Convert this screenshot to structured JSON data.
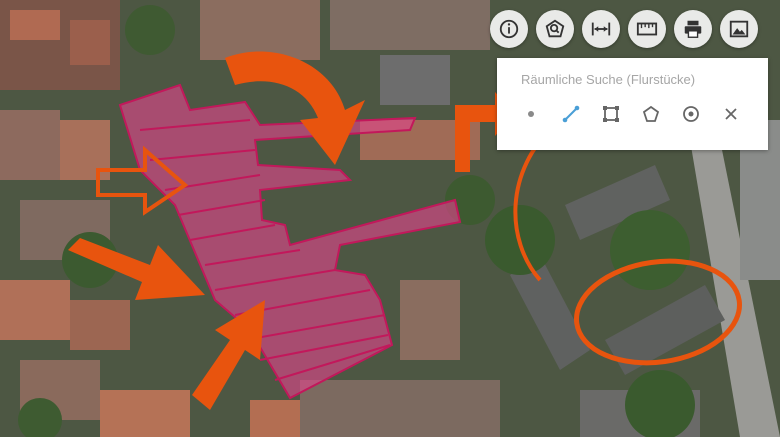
{
  "map": {
    "background": "aerial-photo",
    "parcel_highlight_color": "#e0468c",
    "annotation_color": "#e8540e"
  },
  "toolbar": {
    "items": [
      {
        "icon": "info-icon"
      },
      {
        "icon": "search-location-icon"
      },
      {
        "icon": "measure-distance-icon"
      },
      {
        "icon": "ruler-icon"
      },
      {
        "icon": "print-icon"
      },
      {
        "icon": "image-icon"
      }
    ]
  },
  "spatial_search": {
    "title": "Räumliche Suche (Flurstücke)",
    "active_tool": "line",
    "accent_color": "#4a9fd6",
    "tools": [
      {
        "icon": "point-icon"
      },
      {
        "icon": "line-icon"
      },
      {
        "icon": "rectangle-icon"
      },
      {
        "icon": "polygon-icon"
      },
      {
        "icon": "circle-icon"
      },
      {
        "icon": "close-icon"
      }
    ]
  }
}
